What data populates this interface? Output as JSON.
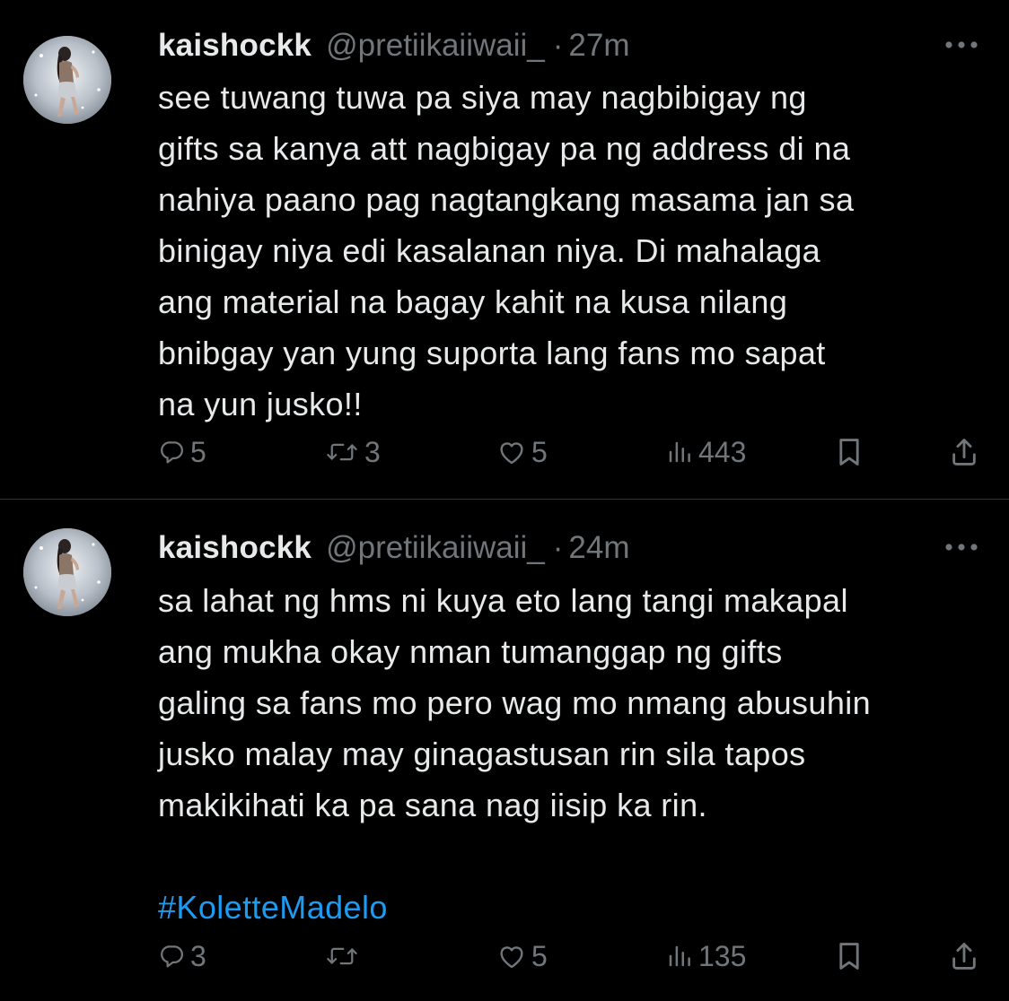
{
  "tweets": [
    {
      "author": {
        "display_name": "kaishockk",
        "handle": "@pretiikaiiwaii_",
        "avatar_icon": "profile-photo"
      },
      "separator": "·",
      "time": "27m",
      "more_icon": "more-horizontal-icon",
      "text_lines": [
        "see tuwang tuwa pa siya may nagbibigay ng",
        "gifts sa kanya att nagbigay pa ng address di na",
        "nahiya paano pag nagtangkang masama jan sa",
        "binigay niya edi kasalanan niya. Di mahalaga",
        "ang material na bagay kahit na kusa nilang",
        "bnibgay yan yung suporta lang fans mo sapat",
        "na yun jusko!!"
      ],
      "stats": {
        "replies": "5",
        "retweets": "3",
        "likes": "5",
        "views": "443"
      }
    },
    {
      "author": {
        "display_name": "kaishockk",
        "handle": "@pretiikaiiwaii_",
        "avatar_icon": "profile-photo"
      },
      "separator": "·",
      "time": "24m",
      "more_icon": "more-horizontal-icon",
      "text_lines": [
        "sa lahat ng hms ni kuya eto lang tangi makapal",
        "ang mukha okay nman tumanggap ng gifts",
        "galing sa fans mo pero wag mo nmang abusuhin",
        "jusko malay may ginagastusan rin sila tapos",
        "makikihati ka pa sana nag iisip ka rin."
      ],
      "hashtag": "#KoletteMadelo",
      "stats": {
        "replies": "3",
        "retweets": "",
        "likes": "5",
        "views": "135"
      }
    }
  ],
  "colors": {
    "background": "#000000",
    "text": "#e7e9ea",
    "secondary": "#71767b",
    "link": "#1d9bf0",
    "divider": "#2f3336"
  }
}
